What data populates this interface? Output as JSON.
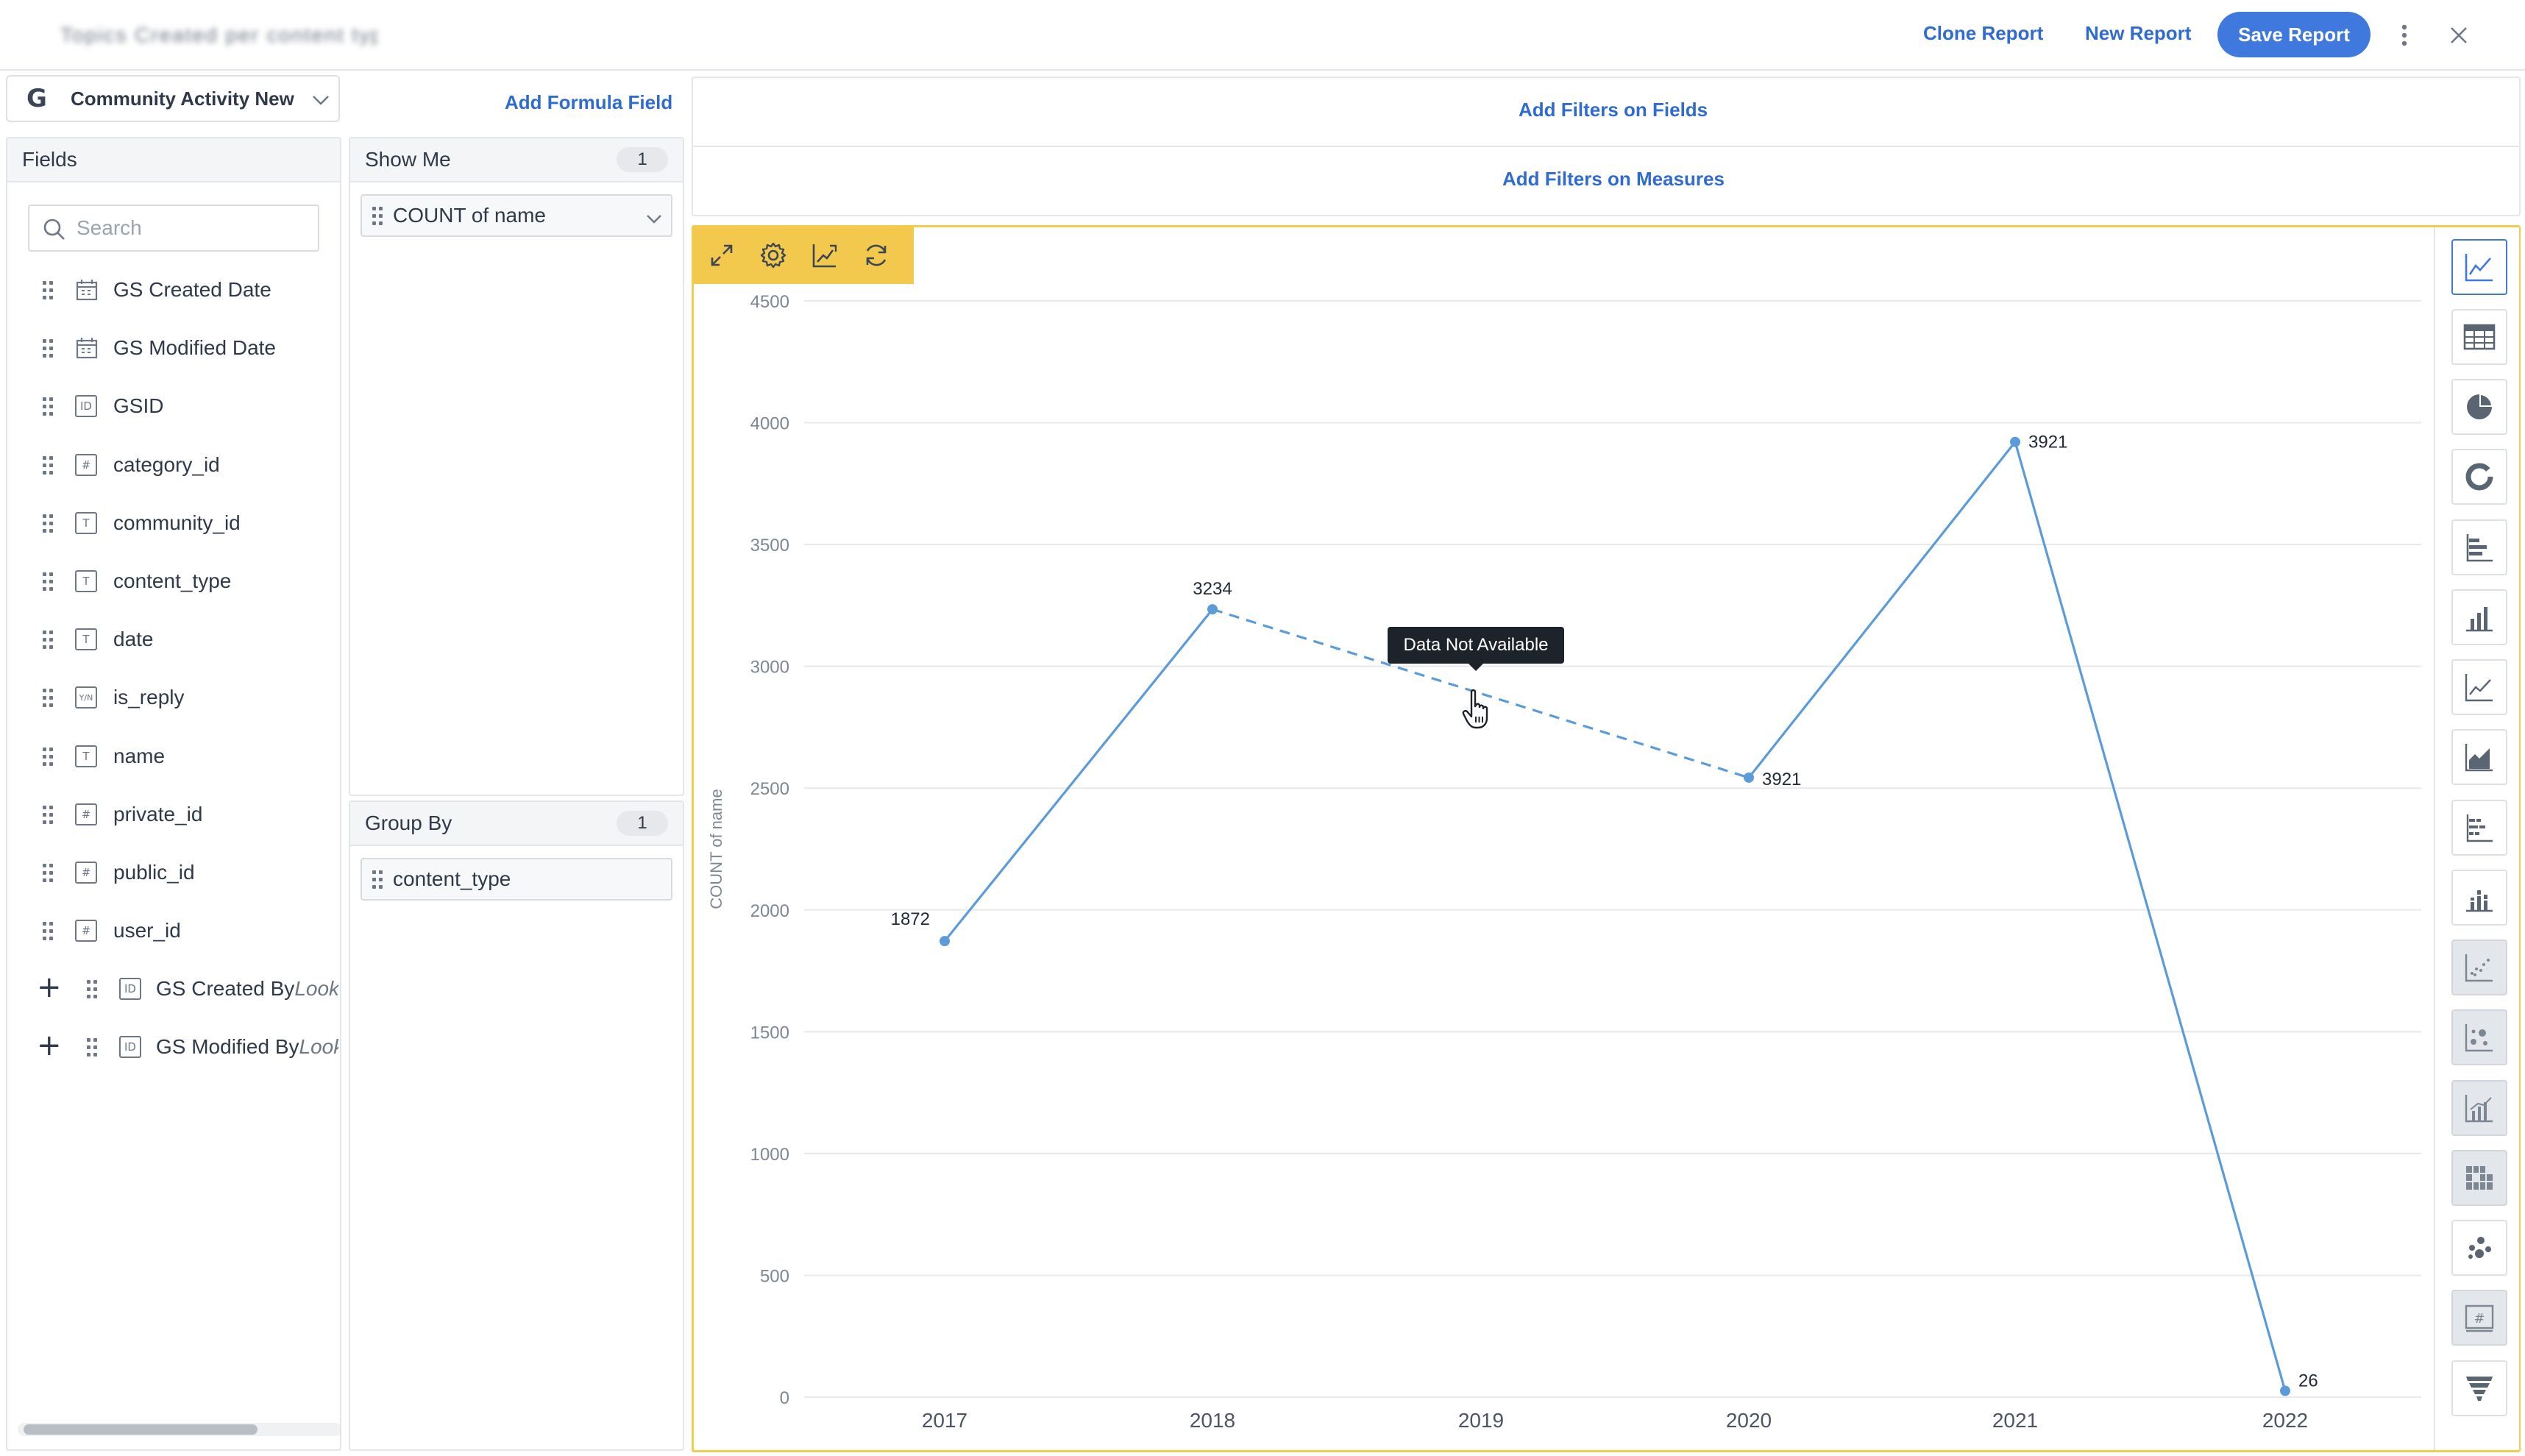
{
  "header": {
    "report_title": "Topics Created per content type",
    "clone_label": "Clone Report",
    "new_label": "New Report",
    "save_label": "Save Report",
    "more_icon": "kebab-vertical-icon",
    "close_icon": "close-icon"
  },
  "source": {
    "name": "Community Activity New",
    "logo_letter": "G"
  },
  "add_formula_label": "Add Formula Field",
  "fields_panel": {
    "title": "Fields",
    "search_placeholder": "Search",
    "items": [
      {
        "name": "GS Created Date",
        "type": "date",
        "icon_label": ""
      },
      {
        "name": "GS Modified Date",
        "type": "date",
        "icon_label": ""
      },
      {
        "name": "GSID",
        "type": "id",
        "icon_label": "ID"
      },
      {
        "name": "category_id",
        "type": "number",
        "icon_label": "#"
      },
      {
        "name": "community_id",
        "type": "text",
        "icon_label": "T"
      },
      {
        "name": "content_type",
        "type": "text",
        "icon_label": "T"
      },
      {
        "name": "date",
        "type": "text",
        "icon_label": "T"
      },
      {
        "name": "is_reply",
        "type": "boolean",
        "icon_label": "Y/N"
      },
      {
        "name": "name",
        "type": "text",
        "icon_label": "T"
      },
      {
        "name": "private_id",
        "type": "number",
        "icon_label": "#"
      },
      {
        "name": "public_id",
        "type": "number",
        "icon_label": "#"
      },
      {
        "name": "user_id",
        "type": "number",
        "icon_label": "#"
      }
    ],
    "lookup_items": [
      {
        "name": "GS Created By",
        "suffix": "Lookup",
        "icon_label": "ID"
      },
      {
        "name": "GS Modified By",
        "suffix": "Lookup",
        "icon_label": "ID"
      }
    ]
  },
  "show_me": {
    "title": "Show Me",
    "count": "1",
    "item": "COUNT of name"
  },
  "group_by": {
    "title": "Group By",
    "count": "1",
    "item": "content_type"
  },
  "filters": {
    "fields_label": "Add Filters on Fields",
    "measures_label": "Add Filters on Measures"
  },
  "toolbar": [
    "expand-icon",
    "settings-gear-icon",
    "chart-edit-icon",
    "refresh-icon"
  ],
  "chart_types": [
    {
      "icon": "line-chart-icon",
      "state": "active"
    },
    {
      "icon": "table-icon",
      "state": "normal"
    },
    {
      "icon": "pie-chart-icon",
      "state": "normal"
    },
    {
      "icon": "donut-chart-icon",
      "state": "normal"
    },
    {
      "icon": "horizontal-bar-icon",
      "state": "normal"
    },
    {
      "icon": "column-chart-icon",
      "state": "normal"
    },
    {
      "icon": "line-chart-alt-icon",
      "state": "normal"
    },
    {
      "icon": "area-chart-icon",
      "state": "normal"
    },
    {
      "icon": "stacked-bar-icon",
      "state": "normal"
    },
    {
      "icon": "stacked-column-icon",
      "state": "normal"
    },
    {
      "icon": "scatter-chart-icon",
      "state": "disabled"
    },
    {
      "icon": "bubble-chart-icon",
      "state": "disabled"
    },
    {
      "icon": "column-line-combo-icon",
      "state": "disabled"
    },
    {
      "icon": "heatmap-icon",
      "state": "disabled"
    },
    {
      "icon": "packed-bubble-icon",
      "state": "normal"
    },
    {
      "icon": "kpi-number-icon",
      "state": "disabled"
    },
    {
      "icon": "funnel-chart-icon",
      "state": "normal"
    }
  ],
  "tooltip_text": "Data Not Available",
  "colors": {
    "accent": "#3f79de",
    "series": "#5b9bd9",
    "toolbar": "#f2c94c"
  },
  "chart_data": {
    "type": "line",
    "ylabel": "COUNT of name",
    "xlabel": "",
    "categories": [
      "2017",
      "2018",
      "2019",
      "2020",
      "2021",
      "2022"
    ],
    "series": [
      {
        "values": [
          1872,
          3234,
          null,
          2543,
          3921,
          26
        ]
      }
    ],
    "data_labels": [
      "1872",
      "3234",
      "",
      "3921",
      "3921",
      "26"
    ],
    "missing_category": "2019",
    "ylim": [
      0,
      4500
    ],
    "yticks": [
      0,
      500,
      1000,
      1500,
      2000,
      2500,
      3000,
      3500,
      4000,
      4500
    ],
    "grid": true,
    "legend": "none"
  }
}
